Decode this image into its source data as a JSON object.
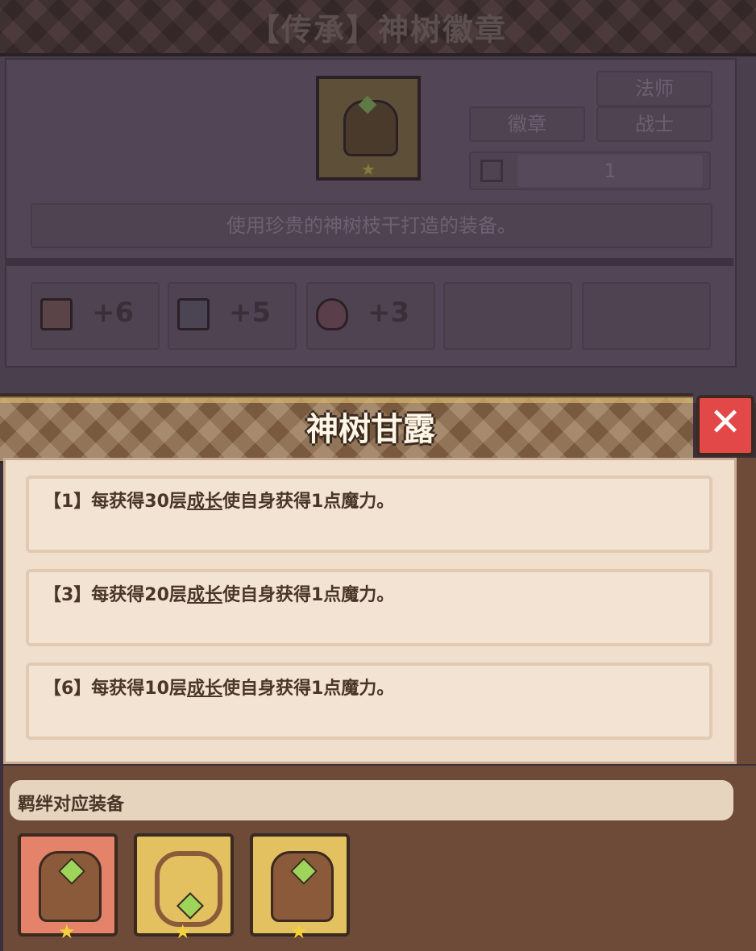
{
  "background_panel": {
    "title": "【传承】神树徽章",
    "tags": [
      "法师",
      "徽章",
      "战士"
    ],
    "count": "1",
    "description": "使用珍贵的神树枝干打造的装备。",
    "stats": [
      {
        "icon": "shield-icon",
        "value": "+6"
      },
      {
        "icon": "book-icon",
        "value": "+5"
      },
      {
        "icon": "heart-icon",
        "value": "+3"
      }
    ]
  },
  "popup": {
    "title": "神树甘露",
    "close_icon": "close-icon",
    "effects": [
      {
        "prefix": "【1】每获得30层",
        "keyword": "成长",
        "suffix": "使自身获得1点魔力。"
      },
      {
        "prefix": "【3】每获得20层",
        "keyword": "成长",
        "suffix": "使自身获得1点魔力。"
      },
      {
        "prefix": "【6】每获得10层",
        "keyword": "成长",
        "suffix": "使自身获得1点魔力。"
      }
    ],
    "bond_label": "羁绊对应装备",
    "bond_items": [
      {
        "icon": "bond-item-pouch-icon",
        "frame_color": "#e5826a"
      },
      {
        "icon": "bond-item-necklace-icon",
        "frame_color": "#e3c161"
      },
      {
        "icon": "bond-item-badge-icon",
        "frame_color": "#e3c161"
      }
    ]
  }
}
